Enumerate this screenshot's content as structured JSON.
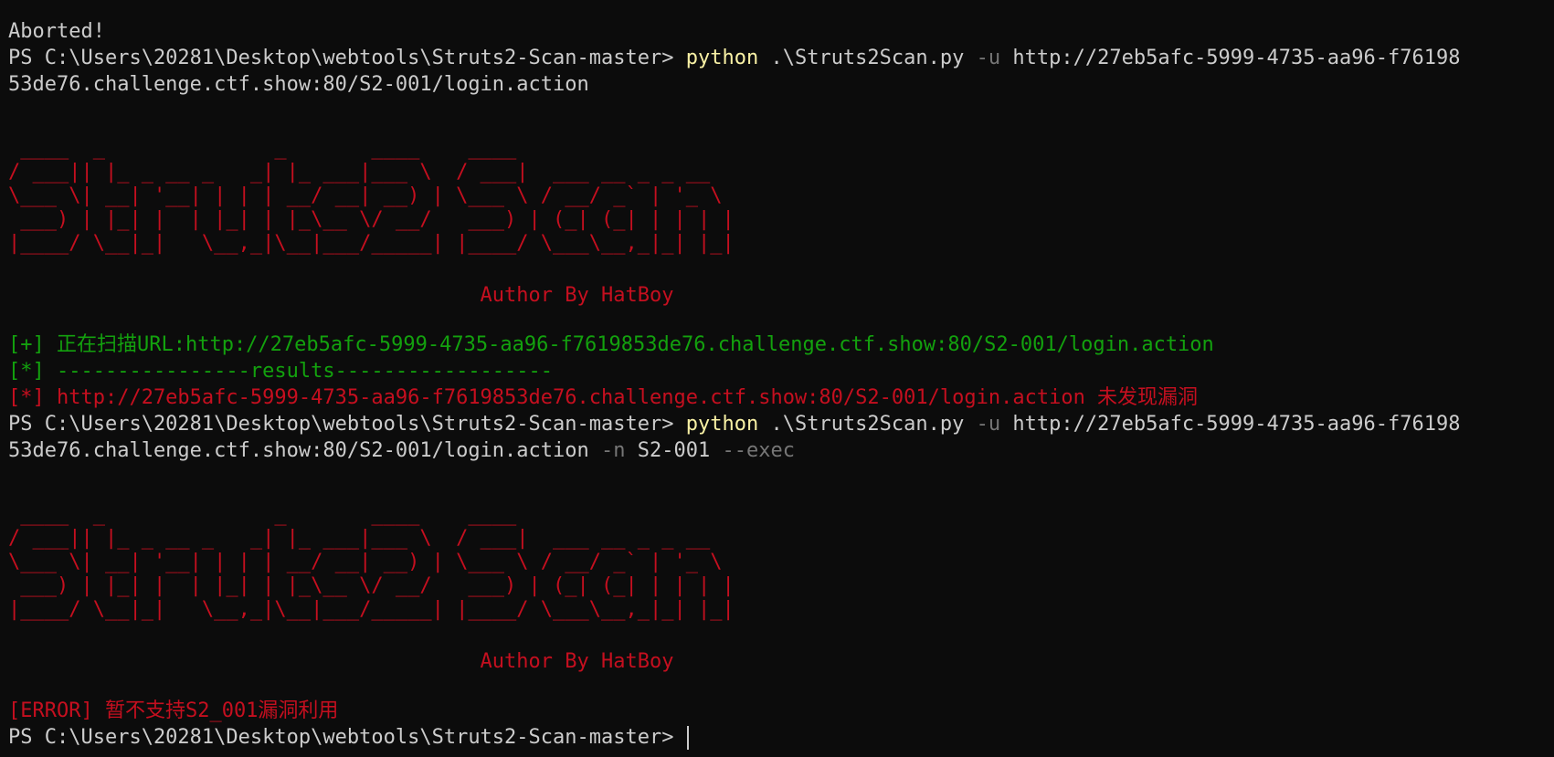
{
  "window": {
    "background": "#0c0c0c",
    "colors": {
      "default": "#cccccc",
      "command": "#f9f1a5",
      "flag": "#767676",
      "error": "#c50f1f",
      "success": "#13a10e"
    }
  },
  "lines": {
    "l1": "Aborted!",
    "l2_prompt": "PS C:\\Users\\20281\\Desktop\\webtools\\Struts2-Scan-master> ",
    "l2_cmd": "python",
    "l2_arg1": " .\\Struts2Scan.py ",
    "l2_flag": "-u",
    "l2_arg2": " http://27eb5afc-5999-4735-aa96-f76198",
    "l3": "53de76.challenge.ctf.show:80/S2-001/login.action",
    "banner1": [
      " ____  _              _       ____    ____",
      "/ ___|| |_ _ __ _   _| |_ ___|___ \\  / ___|  ___ __ _ _ __",
      "\\___ \\| __| '__| | | | __/ __| __) | \\___ \\ / __/ _` | '_ \\",
      " ___) | |_| |  | |_| | |_\\__ \\/ __/   ___) | (_| (_| | | | |",
      "|____/ \\__|_|   \\__,_|\\__|___/_____| |____/ \\___\\__,_|_| |_|"
    ],
    "author1": "                                       Author By HatBoy",
    "scan_info": "[+] 正在扫描URL:http://27eb5afc-5999-4735-aa96-f7619853de76.challenge.ctf.show:80/S2-001/login.action",
    "results_header": "[*] ----------------results------------------",
    "result_line": "[*] http://27eb5afc-5999-4735-aa96-f7619853de76.challenge.ctf.show:80/S2-001/login.action 未发现漏洞",
    "l_cmd2_prompt": "PS C:\\Users\\20281\\Desktop\\webtools\\Struts2-Scan-master> ",
    "l_cmd2_cmd": "python",
    "l_cmd2_arg1": " .\\Struts2Scan.py ",
    "l_cmd2_flag": "-u",
    "l_cmd2_arg2": " http://27eb5afc-5999-4735-aa96-f76198",
    "l_cmd2_cont": "53de76.challenge.ctf.show:80/S2-001/login.action ",
    "l_cmd2_flag_n": "-n",
    "l_cmd2_arg_n": " S2-001 ",
    "l_cmd2_flag_exec": "--exec",
    "banner2": [
      " ____  _              _       ____    ____",
      "/ ___|| |_ _ __ _   _| |_ ___|___ \\  / ___|  ___ __ _ _ __",
      "\\___ \\| __| '__| | | | __/ __| __) | \\___ \\ / __/ _` | '_ \\",
      " ___) | |_| |  | |_| | |_\\__ \\/ __/   ___) | (_| (_| | | | |",
      "|____/ \\__|_|   \\__,_|\\__|___/_____| |____/ \\___\\__,_|_| |_|"
    ],
    "author2": "                                       Author By HatBoy",
    "error_line": "[ERROR] 暂不支持S2_001漏洞利用",
    "final_prompt": "PS C:\\Users\\20281\\Desktop\\webtools\\Struts2-Scan-master> "
  }
}
